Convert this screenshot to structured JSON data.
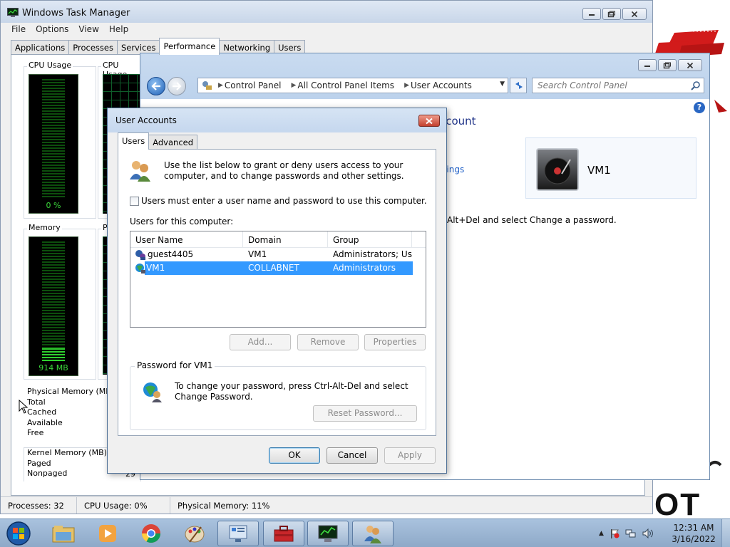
{
  "task_manager": {
    "title": "Windows Task Manager",
    "menu": [
      "File",
      "Options",
      "View",
      "Help"
    ],
    "tabs": [
      "Applications",
      "Processes",
      "Services",
      "Performance",
      "Networking",
      "Users"
    ],
    "active_tab": "Performance",
    "cpu_usage_label": "CPU Usage",
    "cpu_history_label": "CPU Usage",
    "cpu_usage_value": "0 %",
    "memory_label": "Memory",
    "memory_value": "914 MB",
    "memory_history_label": "Ph",
    "physical_memory": {
      "heading": "Physical Memory (MB)",
      "rows": [
        "Total",
        "Cached",
        "Available",
        "Free"
      ]
    },
    "kernel_memory": {
      "heading": "Kernel Memory (MB)",
      "rows": [
        "Paged",
        "Nonpaged"
      ],
      "nonpaged_partial": "29"
    },
    "status": {
      "processes": "Processes: 32",
      "cpu": "CPU Usage: 0%",
      "memory": "Physical Memory: 11%"
    }
  },
  "control_panel": {
    "breadcrumb": [
      "Control Panel",
      "All Control Panel Items",
      "User Accounts"
    ],
    "search_placeholder": "Search Control Panel",
    "heading_fragment": "ccount",
    "link_fragment": "ttings",
    "text_fragment": "Alt+Del and select Change a password.",
    "user_name": "VM1",
    "help_glyph": "?"
  },
  "user_accounts_dialog": {
    "title": "User Accounts",
    "tabs": [
      "Users",
      "Advanced"
    ],
    "active_tab": "Users",
    "intro": "Use the list below to grant or deny users access to your computer, and to change passwords and other settings.",
    "checkbox_label": "Users must enter a user name and password to use this computer.",
    "checkbox_checked": false,
    "users_label": "Users for this computer:",
    "columns": [
      "User Name",
      "Domain",
      "Group"
    ],
    "users": [
      {
        "name": "guest4405",
        "domain": "VM1",
        "group": "Administrators; Us...",
        "selected": false
      },
      {
        "name": "VM1",
        "domain": "COLLABNET",
        "group": "Administrators",
        "selected": true
      }
    ],
    "buttons": {
      "add": "Add...",
      "remove": "Remove",
      "properties": "Properties"
    },
    "password_group_label": "Password for VM1",
    "password_text": "To change your password, press Ctrl-Alt-Del and select Change Password.",
    "reset_password": "Reset Password...",
    "ok": "OK",
    "cancel": "Cancel",
    "apply": "Apply"
  },
  "taskbar": {
    "pinned": [
      "explorer-icon",
      "media-player-icon",
      "chrome-icon",
      "paint-icon",
      "control-panel-icon",
      "toolbox-icon",
      "task-manager-icon",
      "user-accounts-icon"
    ],
    "time": "12:31 AM",
    "date": "3/16/2022"
  },
  "desktop": {
    "wallpaper_text": "OT"
  }
}
